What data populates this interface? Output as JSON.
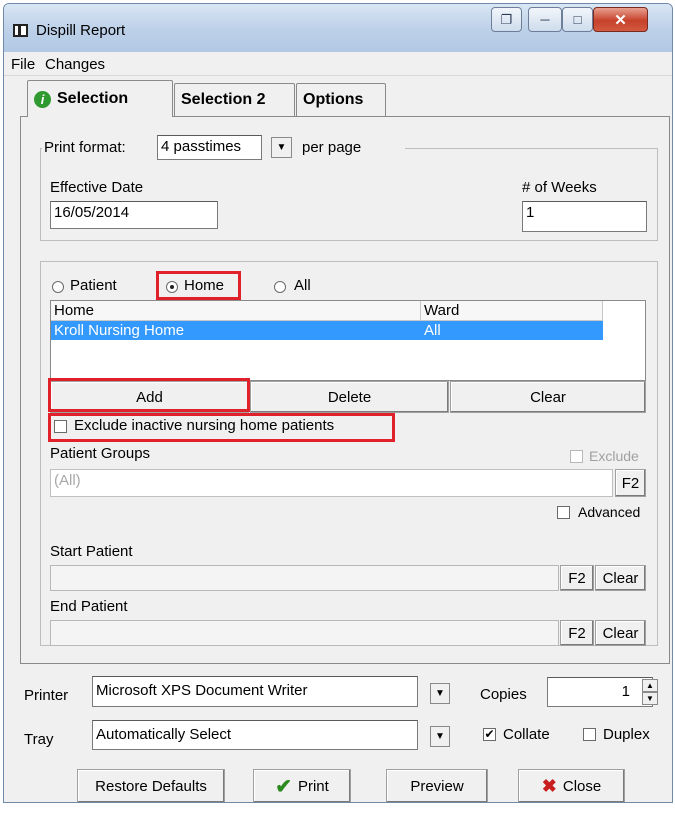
{
  "window": {
    "title": "Dispill Report",
    "icon": "report-window-icon"
  },
  "menu": [
    "File",
    "Changes"
  ],
  "tabs": [
    {
      "label": "Selection",
      "icon": "info-icon",
      "active": true
    },
    {
      "label": "Selection 2",
      "active": false
    },
    {
      "label": "Options",
      "active": false
    }
  ],
  "print_format": {
    "label": "Print format:",
    "value": "4 passtimes",
    "suffix": "per page"
  },
  "effective_date": {
    "label": "Effective Date",
    "value": "16/05/2014"
  },
  "weeks": {
    "label": "# of Weeks",
    "value": "1"
  },
  "selection_mode": {
    "options": [
      "Patient",
      "Home",
      "All"
    ],
    "selected": "Home"
  },
  "home_list": {
    "columns": [
      "Home",
      "Ward"
    ],
    "rows": [
      {
        "home": "Kroll Nursing Home",
        "ward": "All",
        "selected": true
      }
    ]
  },
  "list_buttons": {
    "add": "Add",
    "delete": "Delete",
    "clear": "Clear"
  },
  "exclude_inactive": {
    "label": "Exclude inactive nursing home patients",
    "checked": false
  },
  "patient_groups": {
    "label": "Patient Groups",
    "value": "(All)",
    "exclude_label": "Exclude",
    "f2": "F2",
    "advanced_label": "Advanced"
  },
  "start_patient": {
    "label": "Start Patient",
    "f2": "F2",
    "clear": "Clear"
  },
  "end_patient": {
    "label": "End Patient",
    "f2": "F2",
    "clear": "Clear"
  },
  "printer": {
    "label": "Printer",
    "value": "Microsoft XPS Document Writer"
  },
  "copies": {
    "label": "Copies",
    "value": "1"
  },
  "tray": {
    "label": "Tray",
    "value": "Automatically Select"
  },
  "collate": {
    "label": "Collate",
    "checked": true
  },
  "duplex": {
    "label": "Duplex",
    "checked": false
  },
  "footer_buttons": {
    "restore": "Restore Defaults",
    "print": "Print",
    "preview": "Preview",
    "close": "Close"
  },
  "colors": {
    "selection_blue": "#3399ff",
    "highlight_red": "#e0202a",
    "print_check_green": "#2a8a1e",
    "close_x_red": "#c81e1e"
  }
}
